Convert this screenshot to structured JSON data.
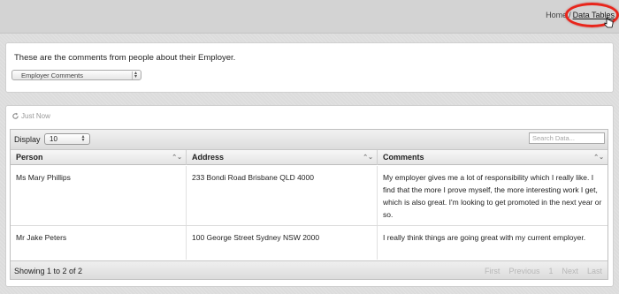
{
  "breadcrumb": {
    "home": "Home",
    "separator": "/",
    "current": "Data Tables"
  },
  "intro": {
    "text": "These are the comments from people about their Employer.",
    "select_value": "Employer Comments"
  },
  "table_panel": {
    "refresh_label": "Just Now",
    "display_label": "Display",
    "display_value": "10",
    "search_placeholder": "Search Data...",
    "columns": [
      "Person",
      "Address",
      "Comments"
    ],
    "rows": [
      {
        "person": "Ms Mary Phillips",
        "address": "233 Bondi Road Brisbane QLD 4000",
        "comment": "My employer gives me a lot of responsibility which I really like. I find that the more I prove myself, the more interesting work I get, which is also great. I'm looking to get promoted in the next year or so."
      },
      {
        "person": "Mr Jake Peters",
        "address": "100 George Street Sydney NSW 2000",
        "comment": "I really think things are going great with my current employer."
      }
    ],
    "info": "Showing 1 to 2 of 2",
    "pager": {
      "first": "First",
      "previous": "Previous",
      "page": "1",
      "next": "Next",
      "last": "Last"
    }
  },
  "colors": {
    "highlight": "#e8251b",
    "background": "#dcdcdc"
  }
}
